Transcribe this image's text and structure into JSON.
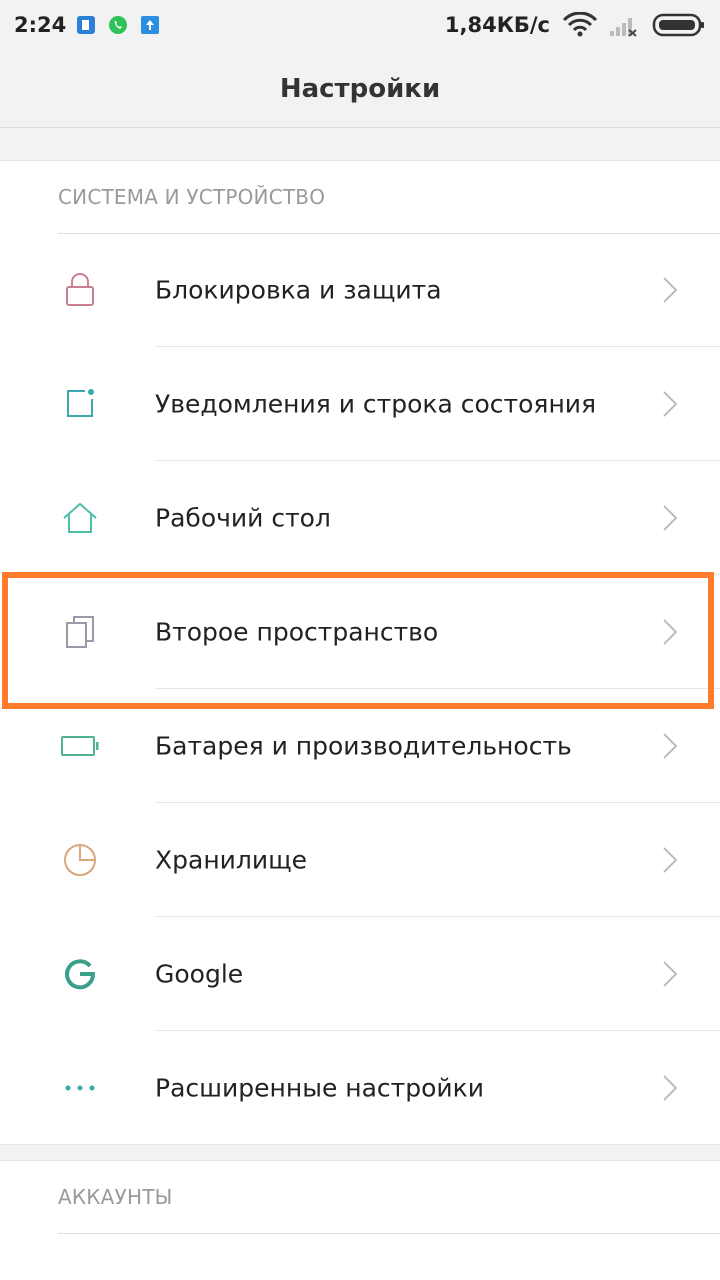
{
  "status_bar": {
    "time": "2:24",
    "speed": "1,84КБ/с",
    "icons": [
      "notification-app-icon",
      "whatsapp-icon",
      "upload-icon",
      "wifi-icon",
      "signal-icon",
      "battery-icon"
    ]
  },
  "header": {
    "title": "Настройки"
  },
  "system_section": {
    "title": "СИСТЕМА И УСТРОЙСТВО",
    "items": [
      {
        "label": "Блокировка и защита",
        "icon": "lock-icon",
        "color": "#c9808e"
      },
      {
        "label": "Уведомления и строка состояния",
        "icon": "notification-icon",
        "color": "#3aa7b5"
      },
      {
        "label": "Рабочий стол",
        "icon": "home-icon",
        "color": "#4fbfa6"
      },
      {
        "label": "Второе пространство",
        "icon": "second-space-icon",
        "color": "#9a9aa8"
      },
      {
        "label": "Батарея и производительность",
        "icon": "battery-icon",
        "color": "#4fb48c"
      },
      {
        "label": "Хранилище",
        "icon": "storage-pie-icon",
        "color": "#d8a878"
      },
      {
        "label": "Google",
        "icon": "google-icon",
        "color": "#3aa08a"
      },
      {
        "label": "Расширенные настройки",
        "icon": "more-dots-icon",
        "color": "#3aa7b5"
      }
    ]
  },
  "accounts_section": {
    "title": "АККАУНТЫ"
  },
  "colors": {
    "highlight": "#ff7a2a",
    "background": "#f2f2f2"
  }
}
